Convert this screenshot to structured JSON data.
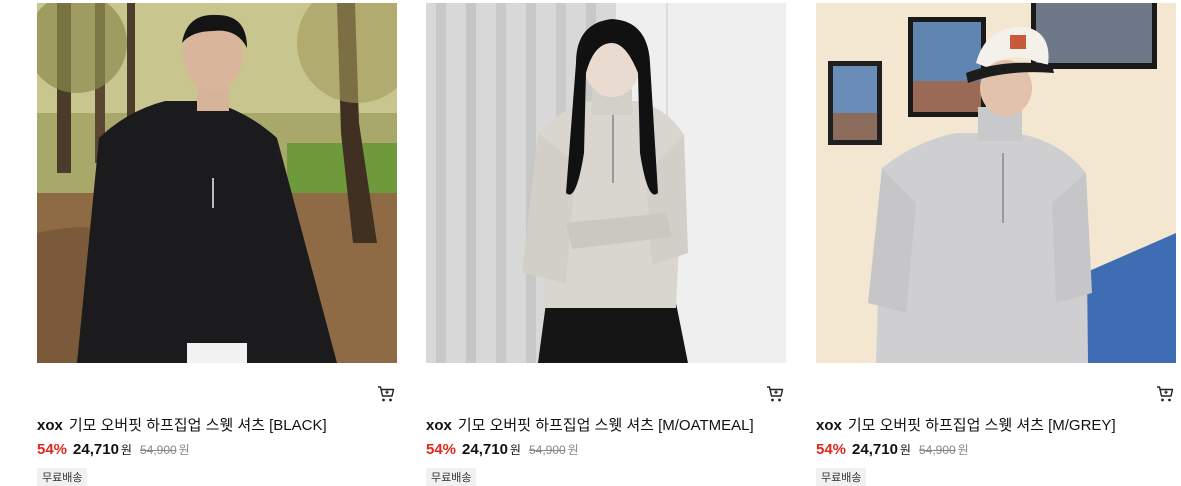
{
  "products": [
    {
      "brand": "xox",
      "name": "기모 오버핏 하프집업 스웻 셔츠 [BLACK]",
      "discount": "54%",
      "price": "24,710",
      "currency": "원",
      "original_price": "54,900",
      "original_currency": "원",
      "badge": "무료배송",
      "sweatshirt_color": "#1b1b1d"
    },
    {
      "brand": "xox",
      "name": "기모 오버핏 하프집업 스웻 셔츠 [M/OATMEAL]",
      "discount": "54%",
      "price": "24,710",
      "currency": "원",
      "original_price": "54,900",
      "original_currency": "원",
      "badge": "무료배송",
      "sweatshirt_color": "#d9d6cf"
    },
    {
      "brand": "xox",
      "name": "기모 오버핏 하프집업 스웻 셔츠 [M/GREY]",
      "discount": "54%",
      "price": "24,710",
      "currency": "원",
      "original_price": "54,900",
      "original_currency": "원",
      "badge": "무료배송",
      "sweatshirt_color": "#cfcfd1"
    }
  ],
  "colors": {
    "discount": "#e0281e",
    "badge_bg": "#f1f1f1",
    "strike": "#888888"
  },
  "icons": {
    "cart": "cart-icon"
  }
}
